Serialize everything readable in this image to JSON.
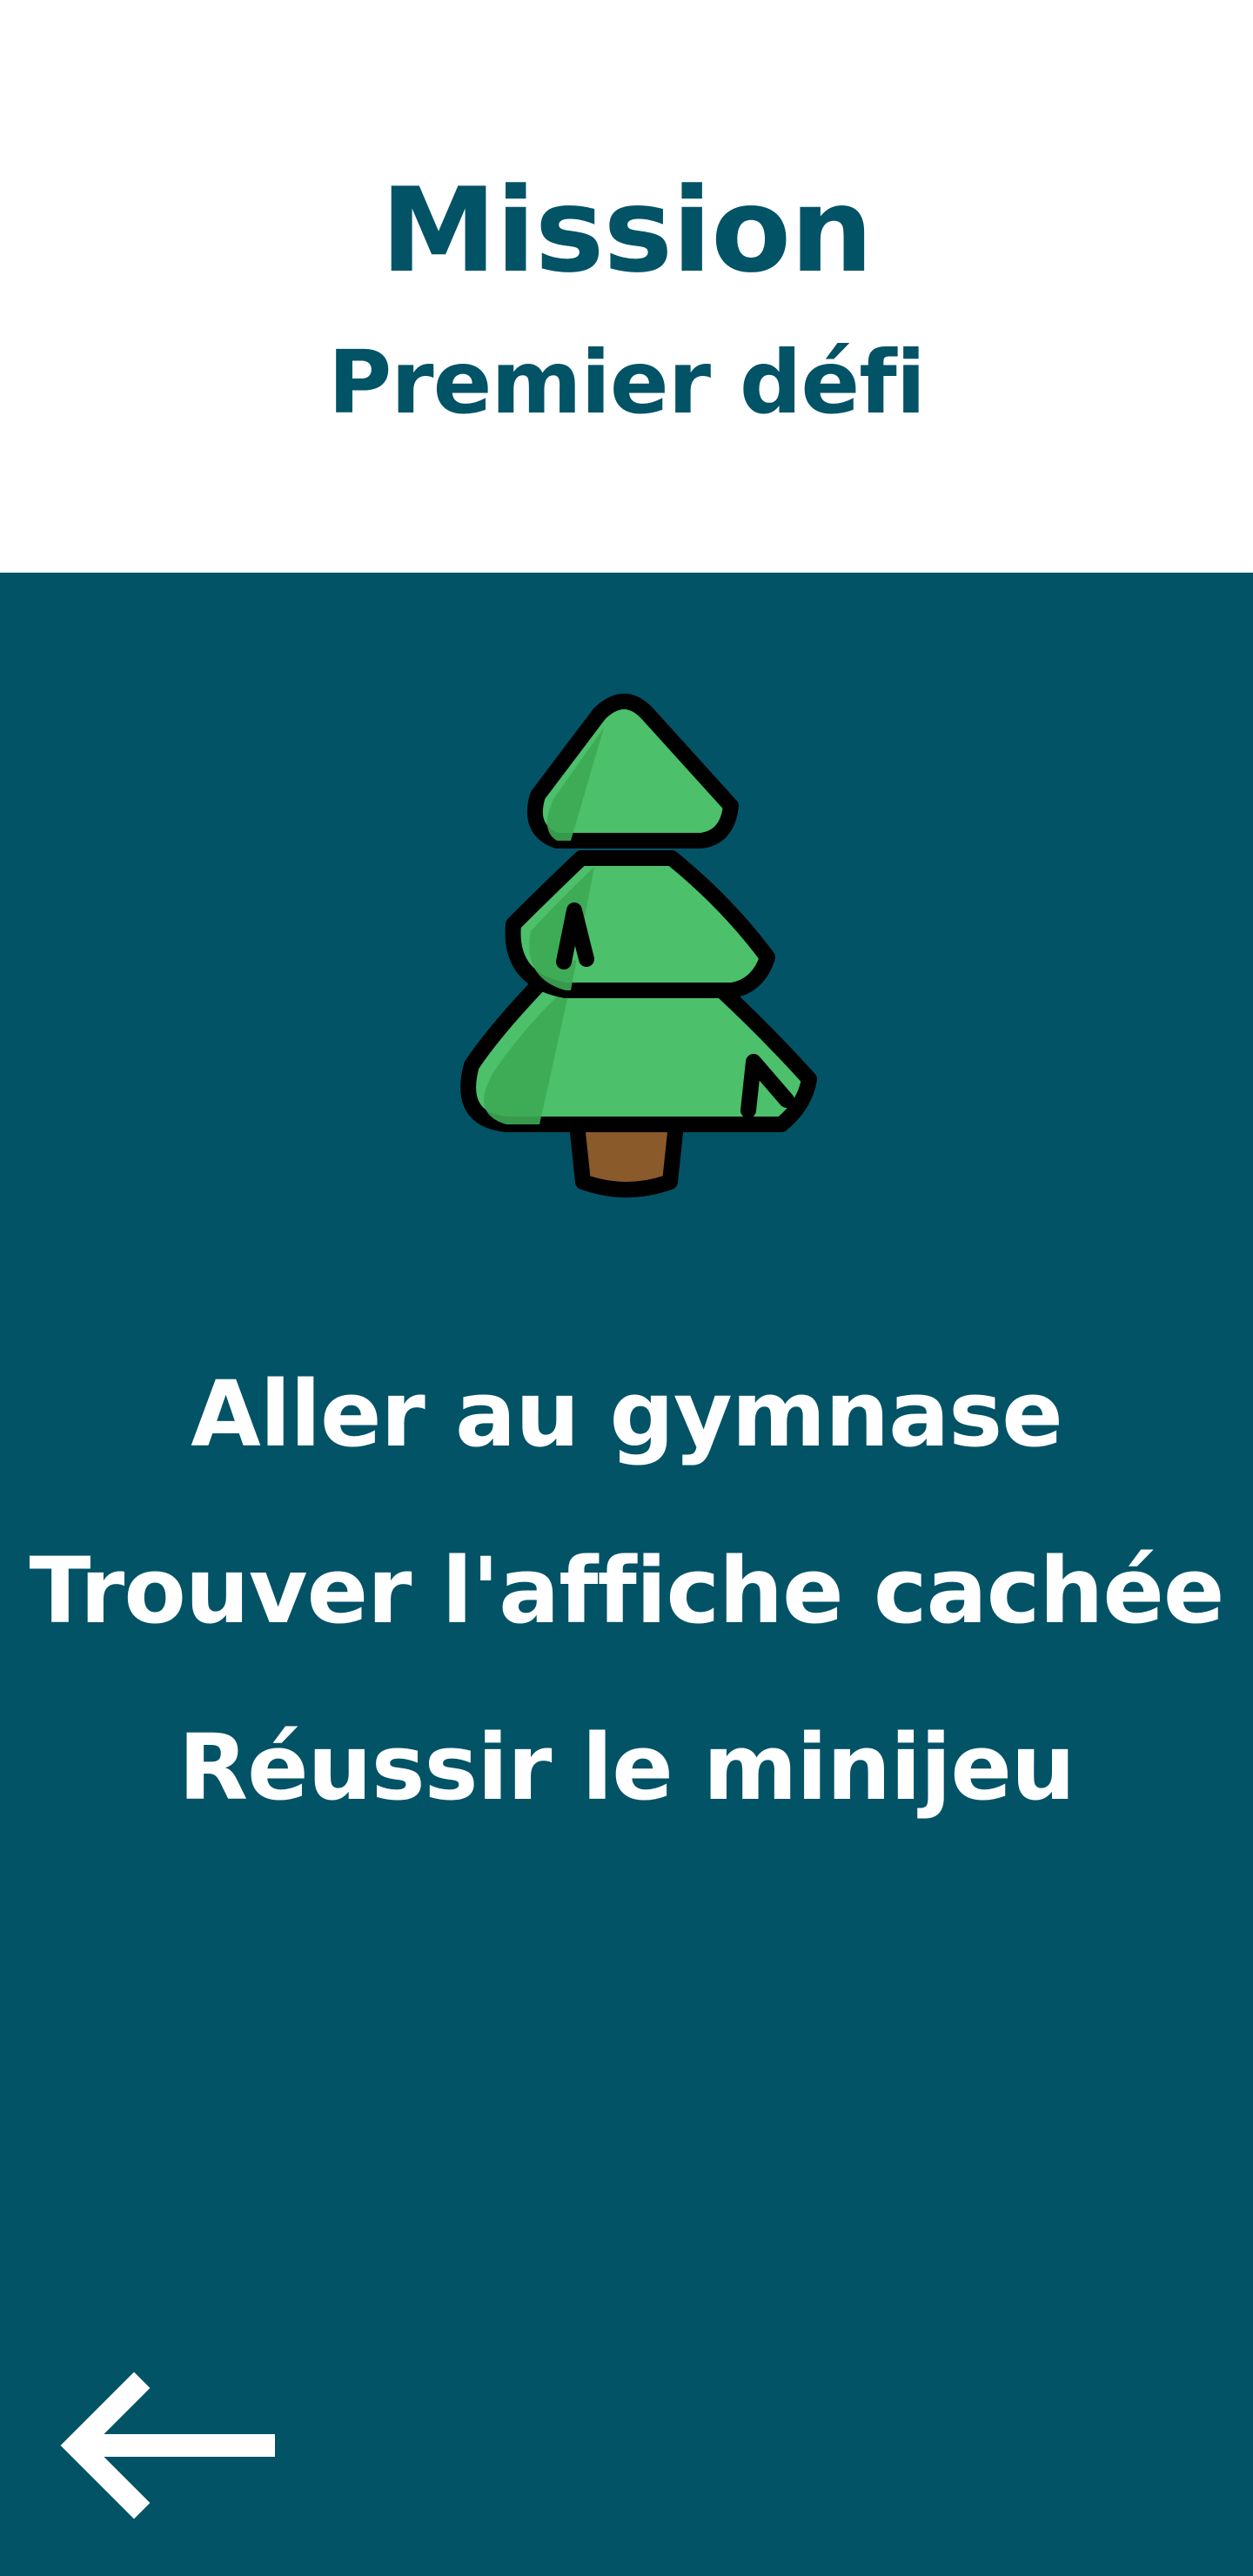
{
  "header": {
    "title": "Mission",
    "subtitle": "Premier défi"
  },
  "mission": {
    "icon": "pine-tree-icon",
    "tasks": [
      "Aller au gymnase",
      "Trouver l'affiche cachée",
      "Réussir le minijeu"
    ]
  },
  "navigation": {
    "back_icon": "arrow-left-icon"
  },
  "colors": {
    "primary": "#035367",
    "background": "#ffffff",
    "text_on_primary": "#ffffff",
    "tree_green": "#4CC06A",
    "tree_shadow": "#3DAA55",
    "trunk_brown": "#8B5A2B"
  }
}
